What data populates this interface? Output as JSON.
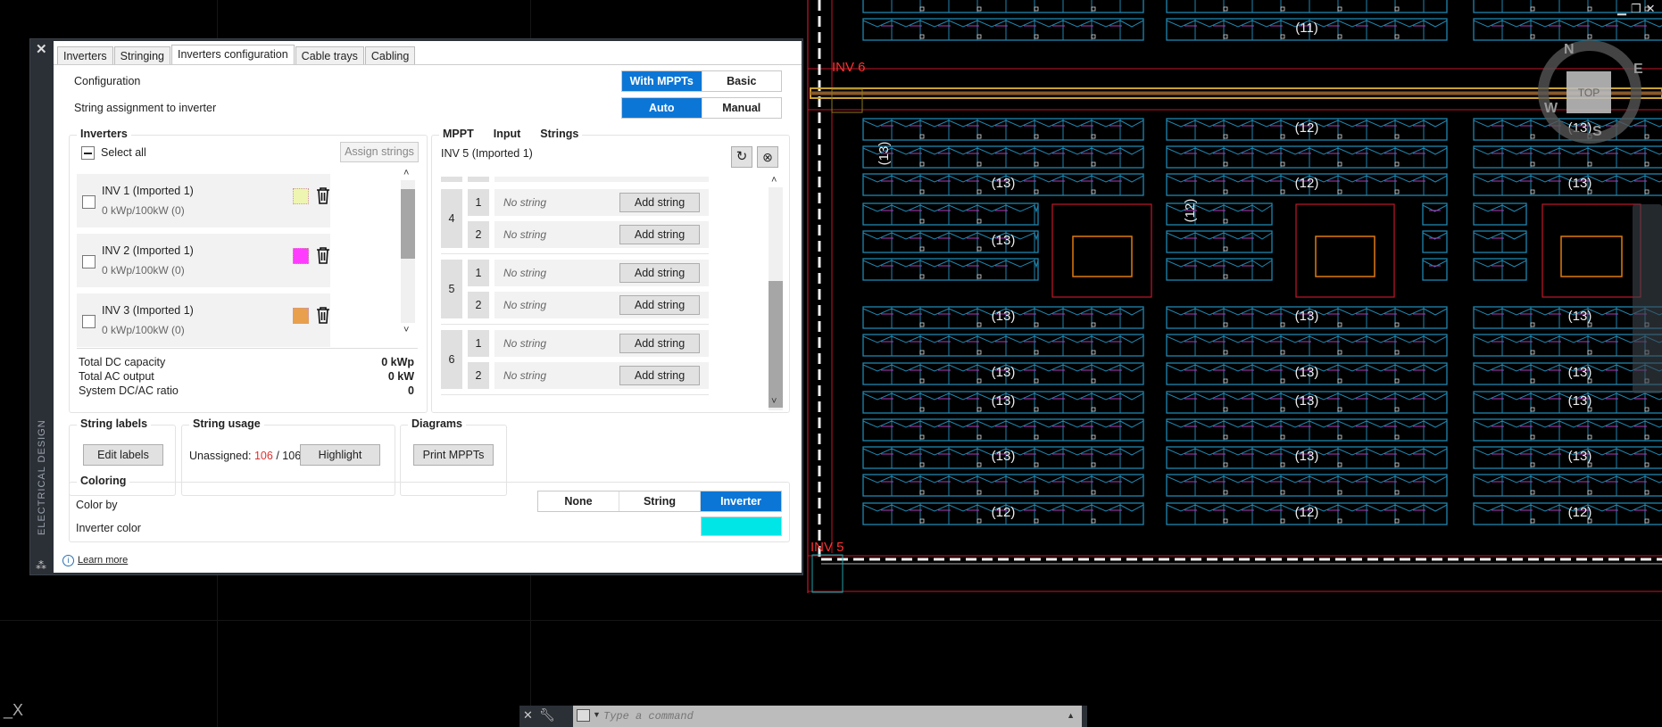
{
  "palette": {
    "side_title": "ELECTRICAL DESIGN",
    "tabs": [
      "Inverters",
      "Stringing",
      "Inverters configuration",
      "Cable trays",
      "Cabling"
    ],
    "active_tab": "Inverters configuration",
    "configuration_label": "Configuration",
    "configuration_options": [
      "With MPPTs",
      "Basic"
    ],
    "configuration_selected": "With MPPTs",
    "assignment_label": "String assignment to inverter",
    "assignment_options": [
      "Auto",
      "Manual"
    ],
    "assignment_selected": "Auto",
    "inverters": {
      "title": "Inverters",
      "select_all": "Select all",
      "assign_button": "Assign strings",
      "items": [
        {
          "name": "INV 1 (Imported 1)",
          "detail": "0 kWp/100kW (0)",
          "color": "#eef5b0"
        },
        {
          "name": "INV 2 (Imported 1)",
          "detail": "0 kWp/100kW (0)",
          "color": "#ff3cff"
        },
        {
          "name": "INV 3 (Imported 1)",
          "detail": "0 kWp/100kW (0)",
          "color": "#e8a04c"
        }
      ],
      "totals": [
        {
          "label": "Total DC capacity",
          "value": "0 kWp"
        },
        {
          "label": "Total AC output",
          "value": "0 kW"
        },
        {
          "label": "System DC/AC ratio",
          "value": "0"
        }
      ]
    },
    "mppt": {
      "headers": [
        "MPPT",
        "Input",
        "Strings"
      ],
      "inverter_name": "INV 5 (Imported 1)",
      "groups": [
        {
          "mppt": "4",
          "inputs": [
            {
              "input": "1",
              "strings": "No string",
              "button": "Add string"
            },
            {
              "input": "2",
              "strings": "No string",
              "button": "Add string"
            }
          ]
        },
        {
          "mppt": "5",
          "inputs": [
            {
              "input": "1",
              "strings": "No string",
              "button": "Add string"
            },
            {
              "input": "2",
              "strings": "No string",
              "button": "Add string"
            }
          ]
        },
        {
          "mppt": "6",
          "inputs": [
            {
              "input": "1",
              "strings": "No string",
              "button": "Add string"
            },
            {
              "input": "2",
              "strings": "No string",
              "button": "Add string"
            }
          ]
        }
      ]
    },
    "string_labels": {
      "title": "String labels",
      "button": "Edit labels"
    },
    "string_usage": {
      "title": "String usage",
      "label": "Unassigned:",
      "unassigned": "106",
      "separator": "/",
      "total": "106",
      "button": "Highlight"
    },
    "diagrams": {
      "title": "Diagrams",
      "button": "Print MPPTs"
    },
    "coloring": {
      "title": "Coloring",
      "color_by_label": "Color by",
      "options": [
        "None",
        "String",
        "Inverter"
      ],
      "selected": "Inverter",
      "inverter_color_label": "Inverter color",
      "inverter_color": "#00e5e5"
    },
    "learn_more": "Learn more"
  },
  "cad": {
    "inverter_labels": [
      "INV 6",
      "INV 5"
    ],
    "viewcube_label": "TOP",
    "compass": [
      "N",
      "E",
      "S",
      "W"
    ],
    "string_counts": [
      {
        "text": "(11)",
        "row": 1,
        "block": 1
      },
      {
        "text": "(12)",
        "row": 2,
        "block": 1
      },
      {
        "text": "(13)",
        "row": 2,
        "block": 2
      },
      {
        "text": "(13)",
        "row": 4,
        "block": 0
      },
      {
        "text": "(12)",
        "row": 4,
        "block": 1
      },
      {
        "text": "(13)",
        "row": 4,
        "block": 2
      },
      {
        "text": "(13)",
        "row": 6,
        "block": 0
      },
      {
        "text": "(13)",
        "row": 8,
        "block": 0
      },
      {
        "text": "(13)",
        "row": 8,
        "block": 1
      },
      {
        "text": "(13)",
        "row": 8,
        "block": 2
      },
      {
        "text": "(13)",
        "row": 10,
        "block": 0
      },
      {
        "text": "(13)",
        "row": 10,
        "block": 1
      },
      {
        "text": "(13)",
        "row": 10,
        "block": 2
      },
      {
        "text": "(13)",
        "row": 11,
        "block": 0
      },
      {
        "text": "(13)",
        "row": 11,
        "block": 1
      },
      {
        "text": "(13)",
        "row": 11,
        "block": 2
      },
      {
        "text": "(13)",
        "row": 13,
        "block": 0
      },
      {
        "text": "(13)",
        "row": 13,
        "block": 1
      },
      {
        "text": "(13)",
        "row": 13,
        "block": 2
      },
      {
        "text": "(12)",
        "row": 15,
        "block": 0
      },
      {
        "text": "(12)",
        "row": 15,
        "block": 1
      },
      {
        "text": "(12)",
        "row": 15,
        "block": 2
      }
    ],
    "vertical_counts": [
      {
        "text": "(13)",
        "row": 3,
        "block": 0
      },
      {
        "text": "(12)",
        "row": 5,
        "block": 1
      }
    ],
    "colors": {
      "module": "#1f86b0",
      "wire": "#b03ab8",
      "boundary": "#c0182a",
      "tray": "#c9a234",
      "inverter_pad": "#e07a10"
    }
  },
  "command_line": {
    "placeholder": "Type a command"
  }
}
